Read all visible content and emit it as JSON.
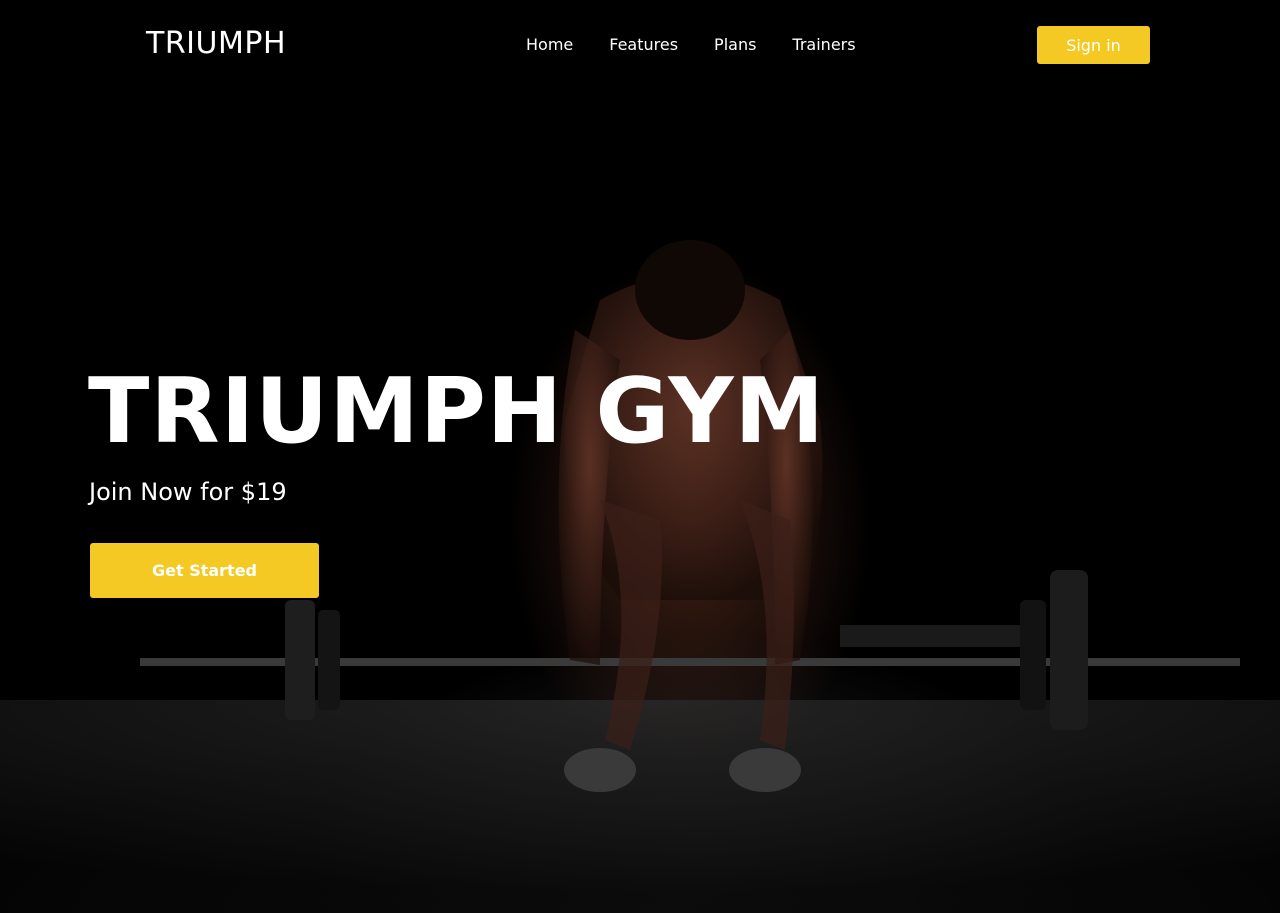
{
  "header": {
    "logo": "TRIUMPH",
    "nav": [
      {
        "label": "Home"
      },
      {
        "label": "Features"
      },
      {
        "label": "Plans"
      },
      {
        "label": "Trainers"
      }
    ],
    "signin_label": "Sign in"
  },
  "hero": {
    "title": "TRIUMPH GYM",
    "subtitle": "Join Now for $19",
    "cta_label": "Get Started",
    "background": "hero-photo"
  },
  "colors": {
    "accent": "#f4c924",
    "background": "#000000",
    "text": "#ffffff"
  }
}
